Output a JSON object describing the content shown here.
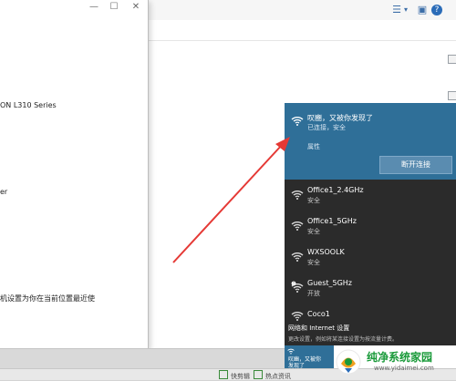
{
  "front_window": {
    "texts": [
      "ON L310 Series",
      "er",
      "机设置为你在当前位置最近使"
    ],
    "controls": {
      "minimize": "—",
      "maximize": "☐",
      "close": "✕"
    }
  },
  "wifi_panel": {
    "connected": {
      "name": "叹豳，又被你发现了",
      "status": "已连接，安全",
      "properties": "属性",
      "disconnect": "断开连接"
    },
    "networks": [
      {
        "name": "Office1_2.4GHz",
        "status": "安全"
      },
      {
        "name": "Office1_5GHz",
        "status": "安全"
      },
      {
        "name": "WXSOOLK",
        "status": "安全"
      },
      {
        "name": "Guest_5GHz",
        "status": "开放"
      },
      {
        "name": "Coco1",
        "status": ""
      }
    ],
    "settings_link": "网络和 Internet 设置",
    "settings_desc": "更改设置，例如将某连接设置为按流量计费。"
  },
  "tray": {
    "line1": "叹豳，又被你",
    "line2": "发现了"
  },
  "taskbar": {
    "items": [
      "快剪辑",
      "热点资讯"
    ]
  },
  "watermark": {
    "title": "纯净系统家园",
    "url": "www.yidaimei.com"
  },
  "colors": {
    "connected_bg": "#2f6f98",
    "flyout_bg": "#2b2b2b",
    "arrow": "#e53935",
    "watermark_green": "#1a9a3a"
  }
}
